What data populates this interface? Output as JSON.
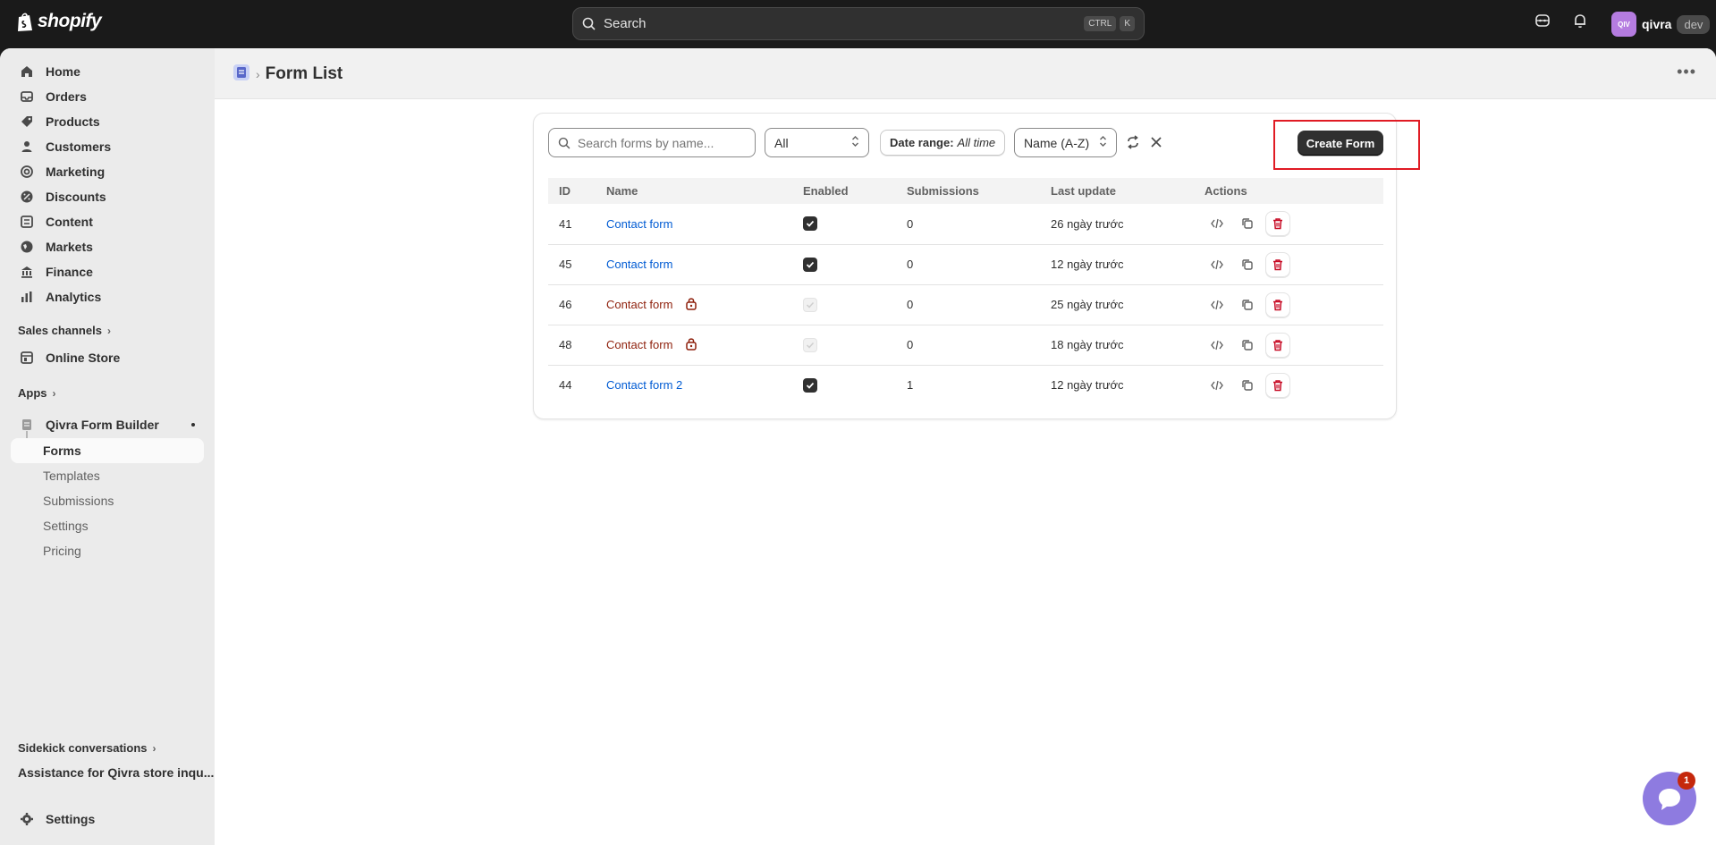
{
  "topbar": {
    "logo_text": "shopify",
    "search_label": "Search",
    "shortcut_keys": [
      "CTRL",
      "K"
    ],
    "user_initials": "QIV",
    "user_name": "qivra",
    "user_badge": "dev"
  },
  "sidebar": {
    "items": [
      {
        "label": "Home",
        "icon": "home-icon"
      },
      {
        "label": "Orders",
        "icon": "inbox-icon"
      },
      {
        "label": "Products",
        "icon": "tag-icon"
      },
      {
        "label": "Customers",
        "icon": "person-icon"
      },
      {
        "label": "Marketing",
        "icon": "target-icon"
      },
      {
        "label": "Discounts",
        "icon": "discount-icon"
      },
      {
        "label": "Content",
        "icon": "content-icon"
      },
      {
        "label": "Markets",
        "icon": "globe-icon"
      },
      {
        "label": "Finance",
        "icon": "bank-icon"
      },
      {
        "label": "Analytics",
        "icon": "chart-icon"
      }
    ],
    "sales_channels_label": "Sales channels",
    "online_store_label": "Online Store",
    "apps_label": "Apps",
    "app_name": "Qivra Form Builder",
    "app_subitems": [
      "Forms",
      "Templates",
      "Submissions",
      "Settings",
      "Pricing"
    ],
    "sidekick_label": "Sidekick conversations",
    "sidekick_item": "Assistance for Qivra store inqu...",
    "settings_label": "Settings"
  },
  "header": {
    "title": "Form List"
  },
  "filters": {
    "search_placeholder": "Search forms by name...",
    "status_value": "All",
    "date_range_label": "Date range:",
    "date_range_value": "All time",
    "sort_value": "Name (A-Z)",
    "create_label": "Create Form"
  },
  "table": {
    "columns": [
      "ID",
      "Name",
      "Enabled",
      "Submissions",
      "Last update",
      "Actions"
    ],
    "rows": [
      {
        "id": "41",
        "name": "Contact form",
        "enabled": true,
        "locked": false,
        "submissions": "0",
        "updated": "26 ngày trước"
      },
      {
        "id": "45",
        "name": "Contact form",
        "enabled": true,
        "locked": false,
        "submissions": "0",
        "updated": "12 ngày trước"
      },
      {
        "id": "46",
        "name": "Contact form",
        "enabled": false,
        "locked": true,
        "submissions": "0",
        "updated": "25 ngày trước"
      },
      {
        "id": "48",
        "name": "Contact form",
        "enabled": false,
        "locked": true,
        "submissions": "0",
        "updated": "18 ngày trước"
      },
      {
        "id": "44",
        "name": "Contact form 2",
        "enabled": true,
        "locked": false,
        "submissions": "1",
        "updated": "12 ngày trước"
      }
    ]
  },
  "chat": {
    "badge_count": "1"
  },
  "colors": {
    "link": "#005bd3",
    "locked_link": "#8e1f0b",
    "danger": "#c70a24",
    "highlight": "#e01b24",
    "chat": "#8e7be0"
  }
}
